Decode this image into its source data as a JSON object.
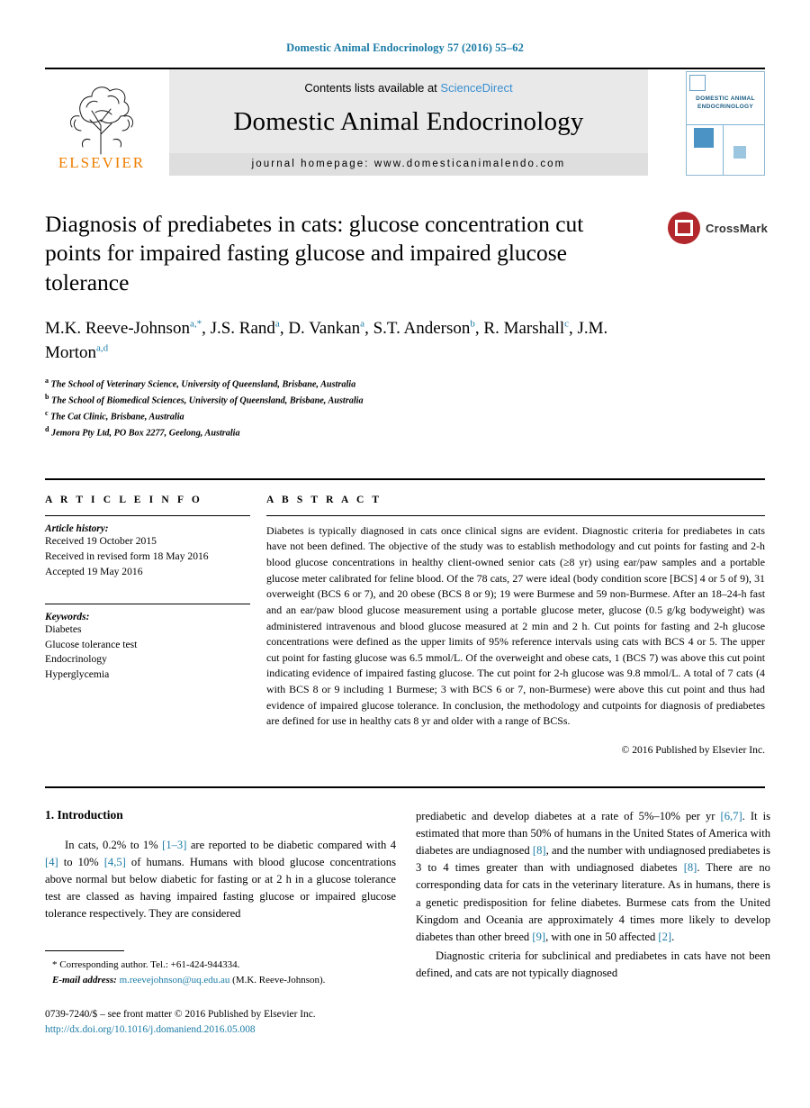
{
  "running_head": "Domestic Animal Endocrinology 57 (2016) 55–62",
  "masthead": {
    "contents_prefix": "Contents lists available at ",
    "sciencedirect": "ScienceDirect",
    "journal_name": "Domestic Animal Endocrinology",
    "homepage": "journal homepage: www.domesticanimalendo.com",
    "publisher_logo_text": "ELSEVIER",
    "cover_title": "DOMESTIC ANIMAL ENDOCRINOLOGY"
  },
  "article": {
    "title": "Diagnosis of prediabetes in cats: glucose concentration cut points for impaired fasting glucose and impaired glucose tolerance",
    "crossmark_label": "CrossMark",
    "authors_line1": "M.K. Reeve-Johnson",
    "authors": [
      {
        "name": "M.K. Reeve-Johnson",
        "marks": "a,*"
      },
      {
        "name": "J.S. Rand",
        "marks": "a"
      },
      {
        "name": "D. Vankan",
        "marks": "a"
      },
      {
        "name": "S.T. Anderson",
        "marks": "b"
      },
      {
        "name": "R. Marshall",
        "marks": "c"
      },
      {
        "name": "J.M. Morton",
        "marks": "a,d"
      }
    ],
    "affiliations": [
      {
        "mark": "a",
        "text": "The School of Veterinary Science, University of Queensland, Brisbane, Australia"
      },
      {
        "mark": "b",
        "text": "The School of Biomedical Sciences, University of Queensland, Brisbane, Australia"
      },
      {
        "mark": "c",
        "text": "The Cat Clinic, Brisbane, Australia"
      },
      {
        "mark": "d",
        "text": "Jemora Pty Ltd, PO Box 2277, Geelong, Australia"
      }
    ]
  },
  "article_info": {
    "heading": "A R T I C L E   I N F O",
    "history_label": "Article history:",
    "history": [
      "Received 19 October 2015",
      "Received in revised form 18 May 2016",
      "Accepted 19 May 2016"
    ],
    "keywords_label": "Keywords:",
    "keywords": [
      "Diabetes",
      "Glucose tolerance test",
      "Endocrinology",
      "Hyperglycemia"
    ]
  },
  "abstract": {
    "heading": "A B S T R A C T",
    "text": "Diabetes is typically diagnosed in cats once clinical signs are evident. Diagnostic criteria for prediabetes in cats have not been defined. The objective of the study was to establish methodology and cut points for fasting and 2-h blood glucose concentrations in healthy client-owned senior cats (≥8 yr) using ear/paw samples and a portable glucose meter calibrated for feline blood. Of the 78 cats, 27 were ideal (body condition score [BCS] 4 or 5 of 9), 31 overweight (BCS 6 or 7), and 20 obese (BCS 8 or 9); 19 were Burmese and 59 non-Burmese. After an 18–24-h fast and an ear/paw blood glucose measurement using a portable glucose meter, glucose (0.5 g/kg bodyweight) was administered intravenous and blood glucose measured at 2 min and 2 h. Cut points for fasting and 2-h glucose concentrations were defined as the upper limits of 95% reference intervals using cats with BCS 4 or 5. The upper cut point for fasting glucose was 6.5 mmol/L. Of the overweight and obese cats, 1 (BCS 7) was above this cut point indicating evidence of impaired fasting glucose. The cut point for 2-h glucose was 9.8 mmol/L. A total of 7 cats (4 with BCS 8 or 9 including 1 Burmese; 3 with BCS 6 or 7, non-Burmese) were above this cut point and thus had evidence of impaired glucose tolerance. In conclusion, the methodology and cutpoints for diagnosis of prediabetes are defined for use in healthy cats 8 yr and older with a range of BCSs.",
    "copyright": "© 2016 Published by Elsevier Inc."
  },
  "body": {
    "section_number_title": "1. Introduction",
    "left_paragraph_parts": [
      {
        "t": "In cats, 0.2% to 1% "
      },
      {
        "t": "[1–3]",
        "ref": true
      },
      {
        "t": " are reported to be diabetic compared with 4 "
      },
      {
        "t": "[4]",
        "ref": true
      },
      {
        "t": " to 10% "
      },
      {
        "t": "[4,5]",
        "ref": true
      },
      {
        "t": " of humans. Humans with blood glucose concentrations above normal but below diabetic for fasting or at 2 h in a glucose tolerance test are classed as having impaired fasting glucose or impaired glucose tolerance respectively. They are considered"
      }
    ],
    "right_paragraph1_parts": [
      {
        "t": "prediabetic and develop diabetes at a rate of 5%–10% per yr "
      },
      {
        "t": "[6,7]",
        "ref": true
      },
      {
        "t": ". It is estimated that more than 50% of humans in the United States of America with diabetes are undiagnosed "
      },
      {
        "t": "[8]",
        "ref": true
      },
      {
        "t": ", and the number with undiagnosed prediabetes is 3 to 4 times greater than with undiagnosed diabetes "
      },
      {
        "t": "[8]",
        "ref": true
      },
      {
        "t": ". There are no corresponding data for cats in the veterinary literature. As in humans, there is a genetic predisposition for feline diabetes. Burmese cats from the United Kingdom and Oceania are approximately 4 times more likely to develop diabetes than other breed "
      },
      {
        "t": "[9]",
        "ref": true
      },
      {
        "t": ", with one in 50 affected "
      },
      {
        "t": "[2]",
        "ref": true
      },
      {
        "t": "."
      }
    ],
    "right_paragraph2": "Diagnostic criteria for subclinical and prediabetes in cats have not been defined, and cats are not typically diagnosed"
  },
  "footnotes": {
    "corresponding": "* Corresponding author. Tel.: +61-424-944334.",
    "email_label": "E-mail address:",
    "email": "m.reevejohnson@uq.edu.au",
    "email_suffix": "(M.K. Reeve-Johnson).",
    "issn_line": "0739-7240/$ – see front matter © 2016 Published by Elsevier Inc.",
    "doi": "http://dx.doi.org/10.1016/j.domaniend.2016.05.008"
  }
}
